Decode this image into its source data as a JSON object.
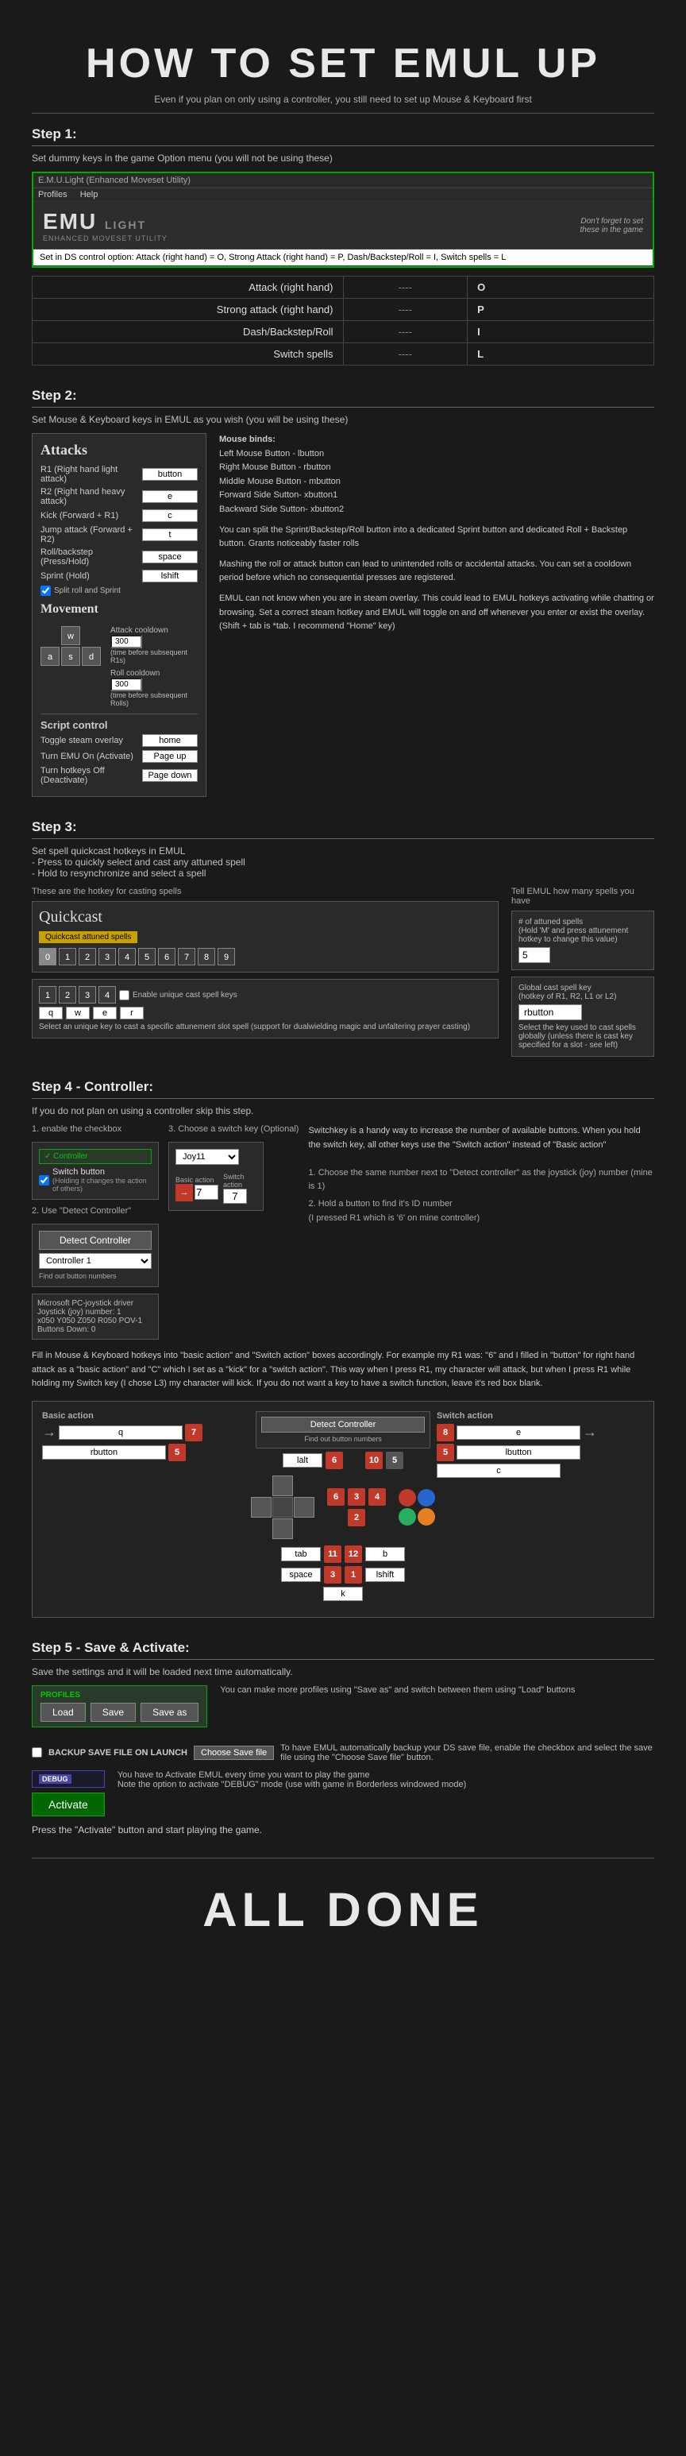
{
  "header": {
    "title": "HOW TO SET EMUL UP",
    "subtitle": "Even if you plan on only using a controller, you still need to set up Mouse & Keyboard first"
  },
  "step1": {
    "title": "Step 1:",
    "desc": "Set dummy keys in the game Option menu (you will not be using these)",
    "emul_window_title": "E.M.U.Light (Enhanced Moveset Utility)",
    "menu_items": [
      "Profiles",
      "Help"
    ],
    "logo": "EMU LIGHT",
    "logo_sub": "ENHANCED MOVESET UTILITY",
    "banner_note": "Don't forget to set\nthese in the game",
    "input_bar": "Set in DS control option: Attack (right hand) = O, Strong Attack (right hand) = P, Dash/Backstep/Roll = I, Switch spells = L",
    "table": [
      {
        "action": "Attack (right hand)",
        "dash": "----",
        "key": "O"
      },
      {
        "action": "Strong attack (right hand)",
        "dash": "----",
        "key": "P"
      },
      {
        "action": "Dash/Backstep/Roll",
        "dash": "----",
        "key": "I"
      },
      {
        "action": "Switch spells",
        "dash": "----",
        "key": "L"
      }
    ]
  },
  "step2": {
    "title": "Step 2:",
    "desc": "Set Mouse & Keyboard keys in EMUL as you wish (you will be using these)",
    "attacks_title": "Attacks",
    "attack_rows": [
      {
        "label": "R1 (Right hand light attack)",
        "key": "button"
      },
      {
        "label": "R2 (Right hand heavy attack)",
        "key": "e"
      },
      {
        "label": "Kick (Forward + R1)",
        "key": "c"
      },
      {
        "label": "Jump attack (Forward + R2)",
        "key": "t"
      },
      {
        "label": "Roll/backstep (Press/Hold)",
        "key": "space"
      },
      {
        "label": "Sprint (Hold)",
        "key": "lshift"
      }
    ],
    "split_roll_sprint": "Split roll and Sprint",
    "movement_title": "Movement",
    "movement_keys": [
      "w",
      "",
      "",
      "a",
      "s",
      "d"
    ],
    "attack_cooldown_label": "Attack cooldown",
    "attack_cooldown_val": "300",
    "attack_cooldown_sub": "(time before subsequent R1s)",
    "roll_cooldown_label": "Roll cooldown",
    "roll_cooldown_val": "300",
    "roll_cooldown_sub": "(time before subsequent Rolls)",
    "script_title": "Script control",
    "script_rows": [
      {
        "label": "Toggle steam overlay",
        "key": "home"
      },
      {
        "label": "Turn EMU On (Activate)",
        "key": "Page up"
      },
      {
        "label": "Turn hotkeys Off (Deactivate)",
        "key": "Page down"
      }
    ],
    "mouse_title": "Mouse binds:",
    "mouse_binds": [
      "Left Mouse Button - lbutton",
      "Right Mouse Button - rbutton",
      "Middle Mouse Button - mbutton",
      "Forward Side Sutton- xbutton1",
      "Backward Side Sutton- xbutton2"
    ],
    "mouse_note1": "You can split the Sprint/Backstep/Roll button into a dedicated Sprint button and dedicated Roll + Backstep button. Grants noticeably faster rolls",
    "mouse_note2": "Mashing the roll or attack button can lead to unintended rolls or accidental attacks. You can set a cooldown period before which no consequential presses are registered.",
    "mouse_note3": "EMUL can not know when you are in steam overlay. This could lead to EMUL hotkeys activating while chatting or browsing. Set a correct steam hotkey and EMUL will toggle on and off whenever you enter or exist the overlay. (Shift + tab is *tab. I recommend \"Home\" key)"
  },
  "step3": {
    "title": "Step 3:",
    "desc1": "Set spell quickcast hotkeys in EMUL",
    "desc2": "- Press to quickly select and cast any attuned spell",
    "desc3": "- Hold to resynchronize and select a spell",
    "hotkey_label": "These are the hotkey for casting spells",
    "quickcast_title": "Quickcast",
    "quickcast_btn": "Quickcast attuned spells",
    "number_keys": [
      "0",
      "1",
      "2",
      "3",
      "4",
      "5",
      "6",
      "7",
      "8",
      "9"
    ],
    "enable_unique_label": "Enable unique cast spell keys",
    "unique_number_keys": [
      "1",
      "2",
      "3",
      "4"
    ],
    "unique_inputs": [
      "q",
      "w",
      "e",
      "r"
    ],
    "unique_desc": "Select an unique key to cast a specific attunement slot spell (support for dualwielding magic and unfaltering prayer casting)",
    "tell_emul_label": "Tell EMUL how many spells you have",
    "spell_count_label": "# of attuned spells\n(Hold 'M' and press attunement\nhotkey to change this value)",
    "spell_count_val": "5",
    "global_cast_label": "Global cast spell key\n(hotkey of R1, R2, L1 or L2)",
    "global_cast_val": "rbutton",
    "global_cast_desc": "Select the key used to cast spells globally (unless there is cast key specified for a slot - see left)"
  },
  "step4": {
    "title": "Step 4 - Controller:",
    "desc": "If you do not plan on using a controller skip this step.",
    "enable_label": "1. enable the checkbox",
    "controller_window_title": "Controller",
    "switch_button_label": "Switch button",
    "switch_button_note": "(Holding it changes the action of others)",
    "detect_label": "2. Use \"Detect Controller\"",
    "detect_btn": "Detect Controller",
    "controller_dropdown": "Controller 1",
    "find_out_note": "Find out button numbers",
    "joystick_info": "Microsoft PC-joystick driver\nJoystick (joy) number: 1\nx050 Y050 Z050 R050 POV-1\nButtons Down: 0",
    "choose_switch_label": "3. Choose a switch key (Optional)",
    "switch_key_dropdown": "Joy11",
    "switch_desc": "Switchkey is a handy way to increase the number of available buttons. When you hold the switch key, all other keys use the \"Switch action\" instead of \"Basic action\"",
    "basic_action_label": "Basic action",
    "switch_action_label": "Switch action",
    "detect_instructions": "1. Choose the same number next to \"Detect controller\" as the joystick (joy) number (mine is 1)\n2. Hold a button to find it's ID number\n(I pressed R1 which is '6' on mine controller)",
    "fill_note": "Fill in Mouse & Keyboard hotkeys into \"basic action\" and \"Switch action\" boxes accordingly. For example my R1 was: \"6\" and I filled in \"button\" for right hand attack as a \"basic action\" and \"C\" which I set as a \"kick\" for a \"switch action\". This way when I press R1, my character will attack, but when I press R1 while holding my Switch key (I chose L3) my character will kick. If you do not want a key to have a switch function, leave it's red box blank.",
    "basic_action_title": "Basic action",
    "switch_action_title": "Switch action",
    "diagram_inputs": {
      "basic": [
        {
          "key": "q",
          "num": "7"
        },
        {
          "key": "rbutton",
          "num": "5"
        }
      ],
      "switch_act": [
        {
          "key": "e",
          "num": "8"
        },
        {
          "key": "lbutton",
          "num": "5"
        },
        {
          "key": "c",
          "num": ""
        }
      ],
      "middle_keys": {
        "lalt": "lalt",
        "num6": "6",
        "num10": "10",
        "num5": "5",
        "num6b": "6",
        "num3": "3",
        "num4": "4",
        "tab": "tab",
        "space": "space",
        "shift": "lshift",
        "num1": "1",
        "num2": "2",
        "num11": "11",
        "num12": "12",
        "b_key": "b",
        "k_key": "k"
      }
    }
  },
  "step5": {
    "title": "Step 5 - Save & Activate:",
    "desc": "Save the settings and it will be loaded next time automatically.",
    "profiles_label": "PROFILES",
    "load_btn": "Load",
    "save_btn": "Save",
    "save_as_btn": "Save as",
    "profiles_note": "You can make more profiles using \"Save as\" and switch between them using \"Load\" buttons",
    "backup_label": "BACKUP SAVE FILE ON LAUNCH",
    "choose_file_btn": "Choose Save file",
    "backup_note": "To have EMUL automatically backup your DS save file, enable the checkbox and select the save file using the \"Choose Save file\" button.",
    "debug_label": "DEBUG",
    "activate_btn": "Activate",
    "activate_note": "You have to Activate EMUL every time you want to play the game\nNote the option to activate \"DEBUG\" mode (use with game in Borderless windowed mode)",
    "press_note": "Press the \"Activate\" button and start playing the game."
  },
  "all_done": {
    "title": "ALL DONE"
  }
}
